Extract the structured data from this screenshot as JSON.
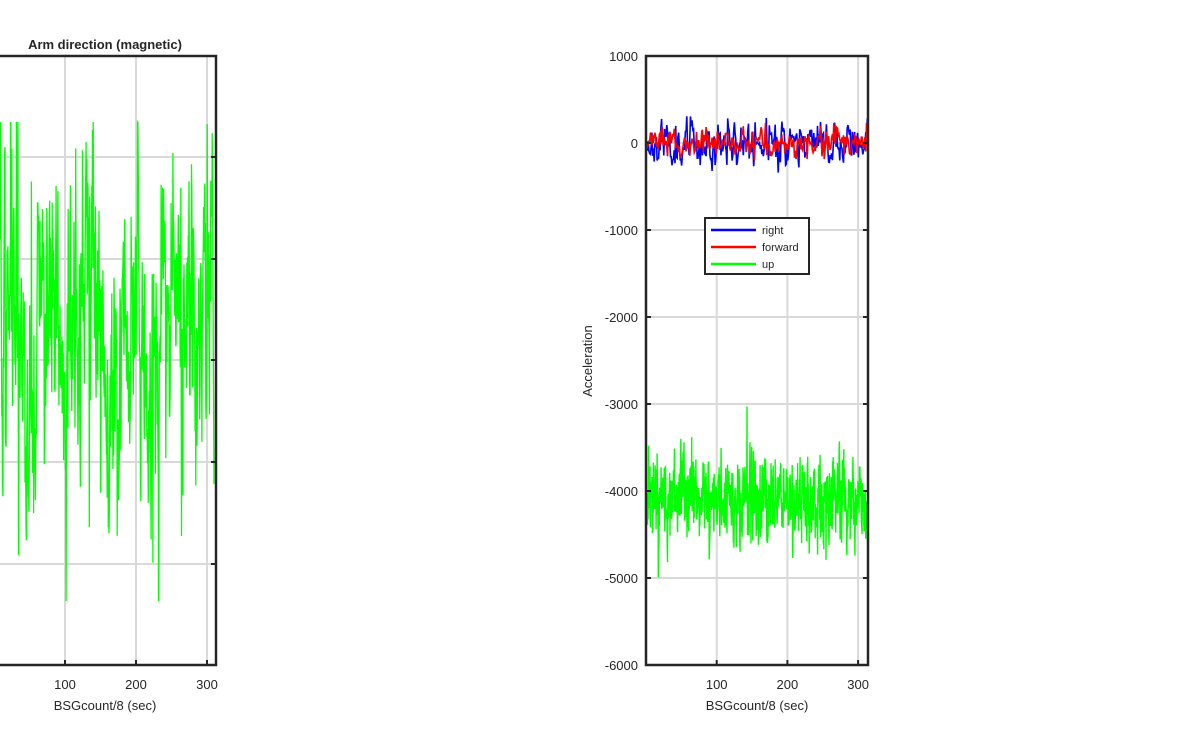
{
  "charts": [
    {
      "type": "line",
      "title": "Arm direction (magnetic)",
      "xlabel": "BSGcount/8 (sec)",
      "ylabel": "",
      "xlim": [
        0,
        314
      ],
      "x_ticks": [
        100,
        200,
        300
      ],
      "y_gridlines": [
        -4,
        -2,
        0,
        2,
        4
      ],
      "grid": true,
      "legend": null,
      "series": [
        {
          "color": "#00ff00",
          "n_points": 600,
          "seed": 7,
          "mean": 0,
          "spread": 1.0
        }
      ]
    },
    {
      "type": "line",
      "title": "",
      "xlabel": "BSGcount/8 (sec)",
      "ylabel": "Acceleration",
      "xlim": [
        0,
        314
      ],
      "ylim": [
        -6000,
        1000
      ],
      "x_ticks": [
        100,
        200,
        300
      ],
      "y_ticks": [
        1000,
        0,
        -1000,
        -2000,
        -3000,
        -4000,
        -5000,
        -6000
      ],
      "grid": true,
      "legend": {
        "position": "upper-center",
        "entries": [
          "right",
          "forward",
          "up"
        ]
      },
      "series": [
        {
          "name": "right",
          "color": "#0000ff",
          "n_points": 300,
          "seed": 11,
          "mean": 0,
          "amp": 120,
          "max_abs": 340
        },
        {
          "name": "forward",
          "color": "#ff0000",
          "n_points": 300,
          "seed": 23,
          "mean": 0,
          "amp": 70,
          "max_abs": 230
        },
        {
          "name": "up",
          "color": "#00ff00",
          "n_points": 900,
          "seed": 37,
          "mean": -4080,
          "amp": 220,
          "max_abs": 1140
        }
      ]
    }
  ]
}
